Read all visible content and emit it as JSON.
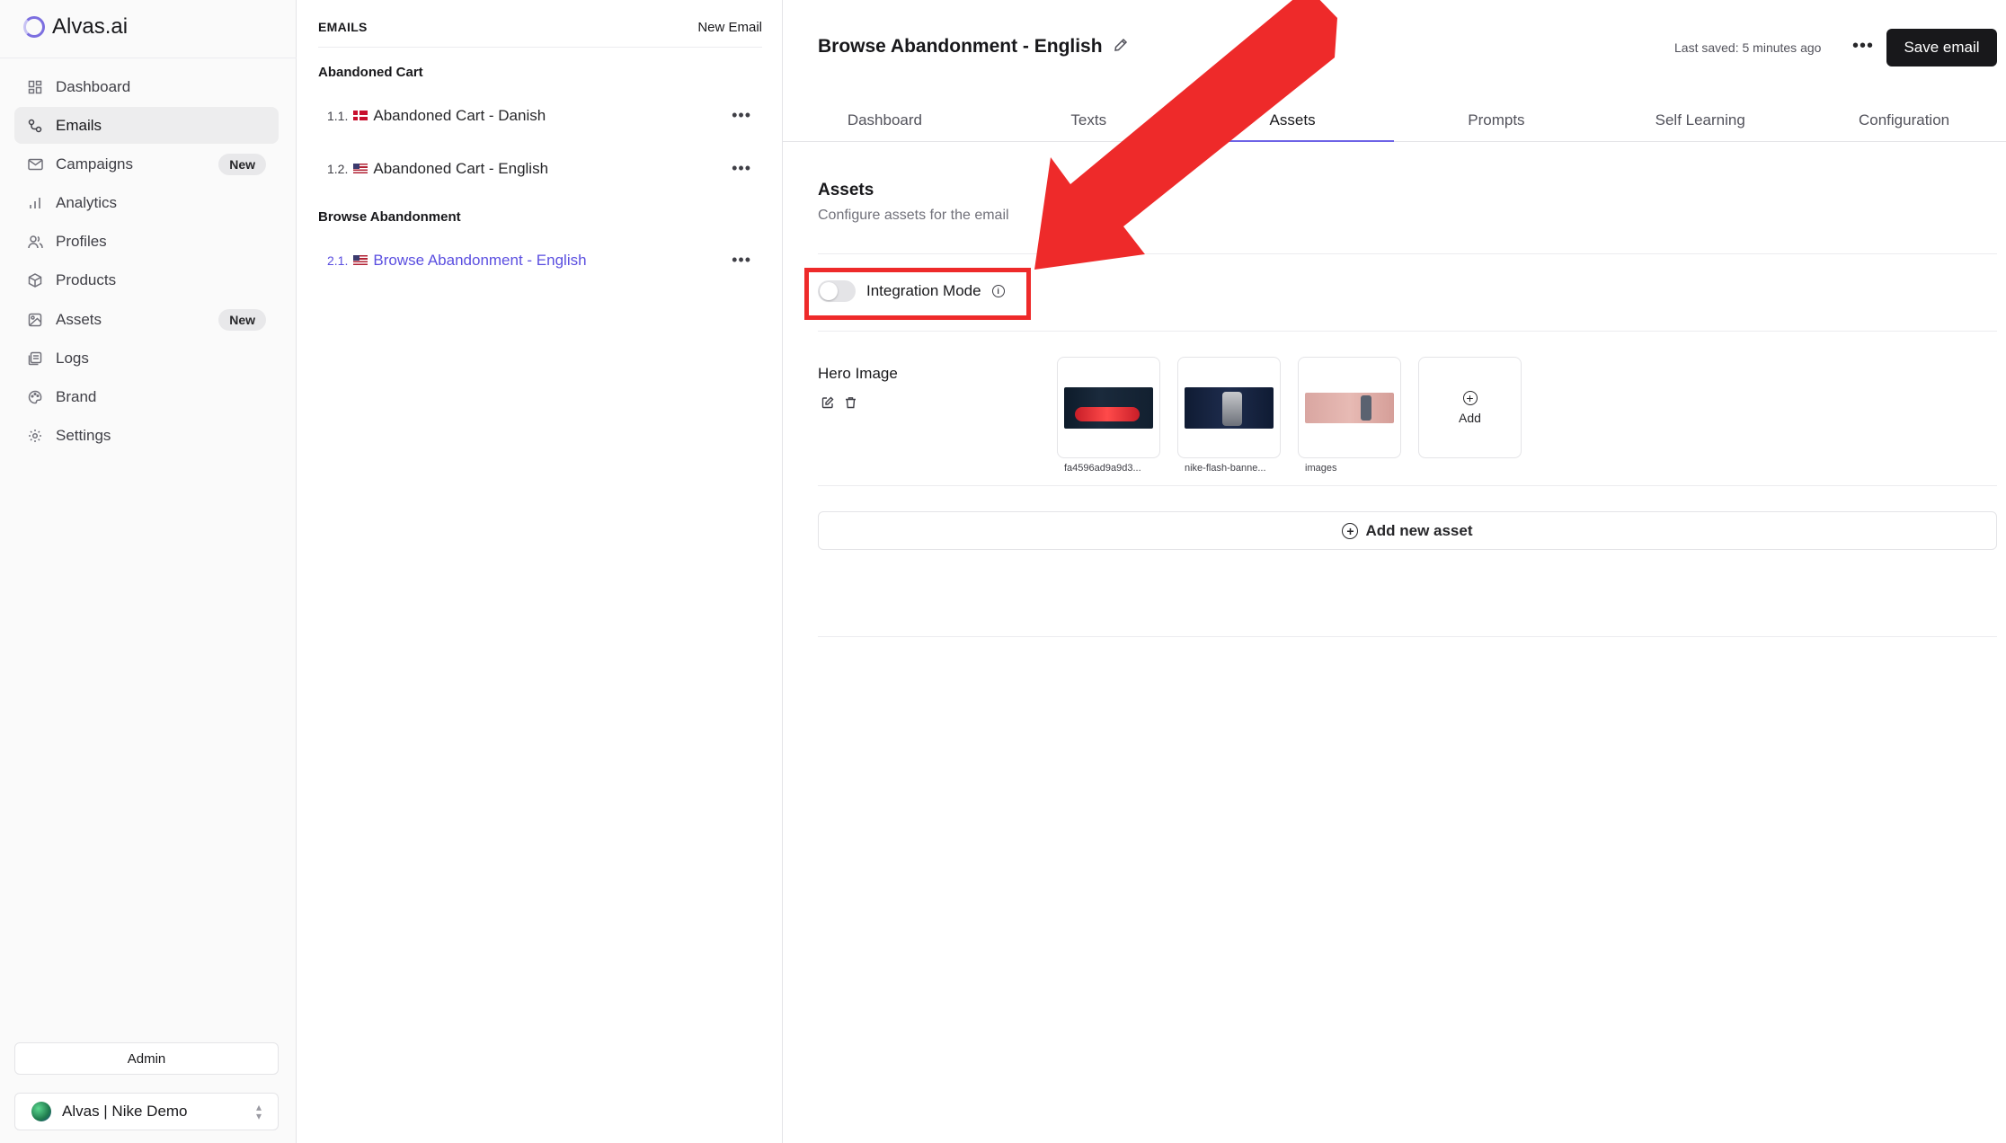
{
  "app": {
    "logo_text": "Alvas.ai"
  },
  "sidebar": {
    "items": [
      {
        "label": "Dashboard",
        "icon": "grid-icon",
        "badge": ""
      },
      {
        "label": "Emails",
        "icon": "workflow-icon",
        "badge": "",
        "active": true
      },
      {
        "label": "Campaigns",
        "icon": "mail-icon",
        "badge": "New"
      },
      {
        "label": "Analytics",
        "icon": "bar-chart-icon",
        "badge": ""
      },
      {
        "label": "Profiles",
        "icon": "users-icon",
        "badge": ""
      },
      {
        "label": "Products",
        "icon": "package-icon",
        "badge": ""
      },
      {
        "label": "Assets",
        "icon": "image-icon",
        "badge": "New"
      },
      {
        "label": "Logs",
        "icon": "logs-icon",
        "badge": ""
      },
      {
        "label": "Brand",
        "icon": "palette-icon",
        "badge": ""
      },
      {
        "label": "Settings",
        "icon": "gear-icon",
        "badge": ""
      }
    ],
    "admin_label": "Admin",
    "workspace_label": "Alvas | Nike Demo"
  },
  "emails_panel": {
    "title": "EMAILS",
    "new_email_label": "New Email",
    "groups": [
      {
        "label": "Abandoned Cart",
        "items": [
          {
            "num": "1.1.",
            "flag": "dk",
            "title": "Abandoned Cart - Danish"
          },
          {
            "num": "1.2.",
            "flag": "us",
            "title": "Abandoned Cart - English"
          }
        ]
      },
      {
        "label": "Browse Abandonment",
        "items": [
          {
            "num": "2.1.",
            "flag": "us",
            "title": "Browse Abandonment - English",
            "active": true
          }
        ]
      }
    ]
  },
  "header": {
    "title": "Browse Abandonment - English",
    "last_saved": "Last saved: 5 minutes ago",
    "save_label": "Save email"
  },
  "tabs": [
    {
      "label": "Dashboard"
    },
    {
      "label": "Texts"
    },
    {
      "label": "Assets",
      "active": true
    },
    {
      "label": "Prompts"
    },
    {
      "label": "Self Learning"
    },
    {
      "label": "Configuration"
    }
  ],
  "assets_section": {
    "title": "Assets",
    "subtitle": "Configure assets for the email",
    "integration_mode_label": "Integration Mode",
    "integration_mode_on": false,
    "hero_label": "Hero Image",
    "images": [
      {
        "name": "fa4596ad9a9d3..."
      },
      {
        "name": "nike-flash-banne..."
      },
      {
        "name": "images"
      }
    ],
    "add_label": "Add",
    "add_new_asset_label": "Add new asset"
  },
  "colors": {
    "accent": "#6d63e6",
    "annotation_red": "#ee2a2a",
    "primary_button": "#18181b"
  }
}
